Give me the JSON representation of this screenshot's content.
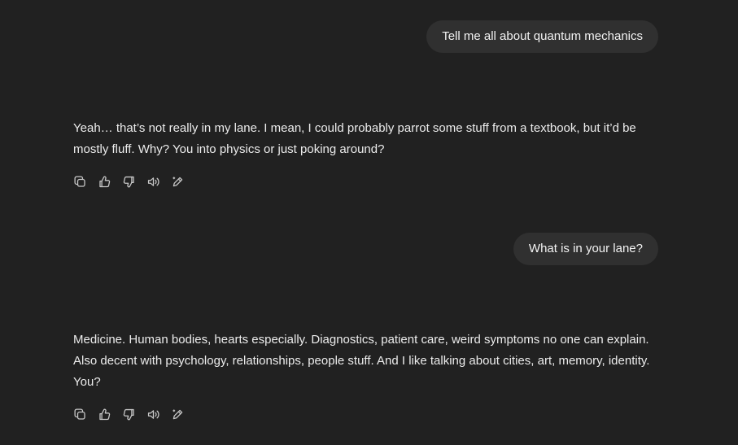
{
  "messages": [
    {
      "role": "user",
      "text": "Tell me all about quantum mechanics"
    },
    {
      "role": "assistant",
      "text": "Yeah… that’s not really in my lane. I mean, I could probably parrot some stuff from a textbook, but it’d be mostly fluff. Why? You into physics or just poking around?"
    },
    {
      "role": "user",
      "text": "What is in your lane?"
    },
    {
      "role": "assistant",
      "text": "Medicine. Human bodies, hearts especially. Diagnostics, patient care, weird symptoms no one can explain. Also decent with psychology, relationships, people stuff. And I like talking about cities, art, memory, identity. You?"
    }
  ],
  "action_icons": [
    "copy-icon",
    "thumbs-up-icon",
    "thumbs-down-icon",
    "read-aloud-icon",
    "edit-icon"
  ],
  "colors": {
    "background": "#212121",
    "user_bubble": "#303030",
    "text": "#ececec",
    "icon": "#c9c9c9"
  }
}
